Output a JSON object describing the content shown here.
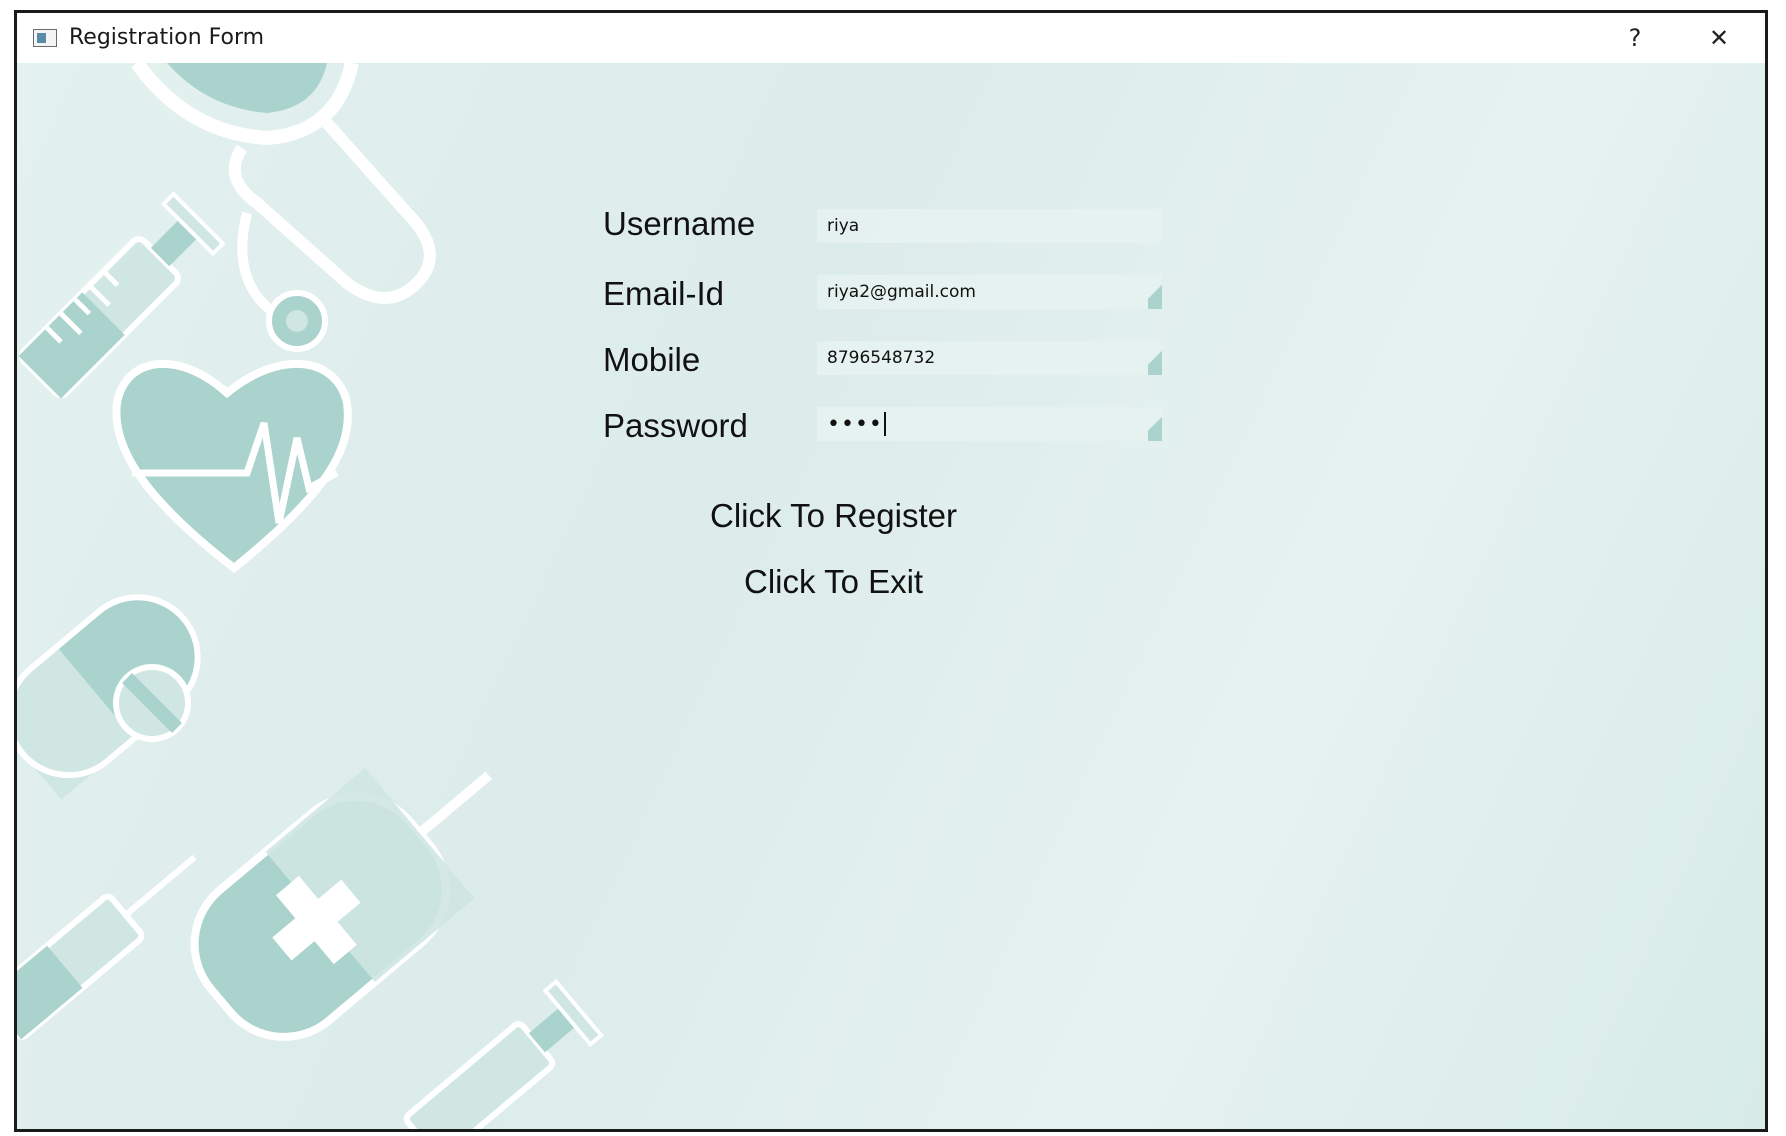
{
  "window": {
    "title": "Registration Form",
    "help_glyph": "?",
    "close_glyph": "✕"
  },
  "form": {
    "username": {
      "label": "Username",
      "value": "riya"
    },
    "email": {
      "label": "Email-Id",
      "value": "riya2@gmail.com"
    },
    "mobile": {
      "label": "Mobile",
      "value": "8796548732"
    },
    "password": {
      "label": "Password",
      "masked_value": "••••"
    }
  },
  "actions": {
    "register_label": "Click To Register",
    "exit_label": "Click To Exit"
  },
  "colors": {
    "background": "#dcecea",
    "art": "#a9d3cc",
    "art_light": "#cfe6e2"
  },
  "icons": [
    "app-icon",
    "help-icon",
    "close-icon",
    "stethoscope-icon",
    "syringe-icon",
    "heart-pulse-icon",
    "pill-icon",
    "medicine-bottle-icon"
  ]
}
